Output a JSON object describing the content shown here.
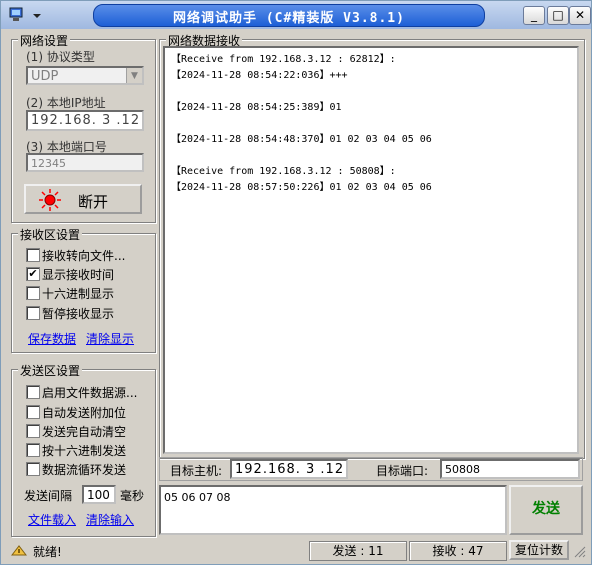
{
  "window": {
    "title": "网络调试助手 (C#精装版 V3.8.1)"
  },
  "title_buttons": {
    "minimize": "_",
    "maximize": "□",
    "close": "✕"
  },
  "network": {
    "group_title": "网络设置",
    "protocol_label": "(1) 协议类型",
    "protocol_value": "UDP",
    "ip_label": "(2) 本地IP地址",
    "ip_value": "192.168. 3 .12",
    "port_label": "(3) 本地端口号",
    "port_value": "12345",
    "disconnect_label": "断开"
  },
  "receive_settings": {
    "group_title": "接收区设置",
    "options": [
      {
        "label": "接收转向文件...",
        "checked": false
      },
      {
        "label": "显示接收时间",
        "checked": true
      },
      {
        "label": "十六进制显示",
        "checked": false
      },
      {
        "label": "暂停接收显示",
        "checked": false
      }
    ],
    "save_link": "保存数据",
    "clear_link": "清除显示"
  },
  "send_settings": {
    "group_title": "发送区设置",
    "options": [
      {
        "label": "启用文件数据源...",
        "checked": false
      },
      {
        "label": "自动发送附加位",
        "checked": false
      },
      {
        "label": "发送完自动清空",
        "checked": false
      },
      {
        "label": "按十六进制发送",
        "checked": false
      },
      {
        "label": "数据流循环发送",
        "checked": false
      }
    ],
    "interval_label": "发送间隔",
    "interval_value": "100",
    "interval_unit": "毫秒",
    "load_link": "文件载入",
    "clear_input_link": "清除输入"
  },
  "receive_area": {
    "title": "网络数据接收",
    "lines": [
      "【Receive from 192.168.3.12 : 62812】:",
      "【2024-11-28 08:54:22:036】+++",
      "",
      "【2024-11-28 08:54:25:389】01",
      "",
      "【2024-11-28 08:54:48:370】01 02 03 04 05 06",
      "",
      "【Receive from 192.168.3.12 : 50808】:",
      "【2024-11-28 08:57:50:226】01 02 03 04 05 06"
    ]
  },
  "target": {
    "host_label": "目标主机:",
    "host_value": "192.168. 3 .12",
    "port_label": "目标端口:",
    "port_value": "50808"
  },
  "send_area": {
    "text": "05 06 07 08",
    "send_button": "发送"
  },
  "status": {
    "ready": "就绪!",
    "sent": "发送 : 11",
    "received": "接收 : 47",
    "reset": "复位计数"
  },
  "colors": {
    "send_button_text": "#008000",
    "link": "#0000ee",
    "title_bar": "#1d5fd6",
    "led": "#ff0000"
  }
}
